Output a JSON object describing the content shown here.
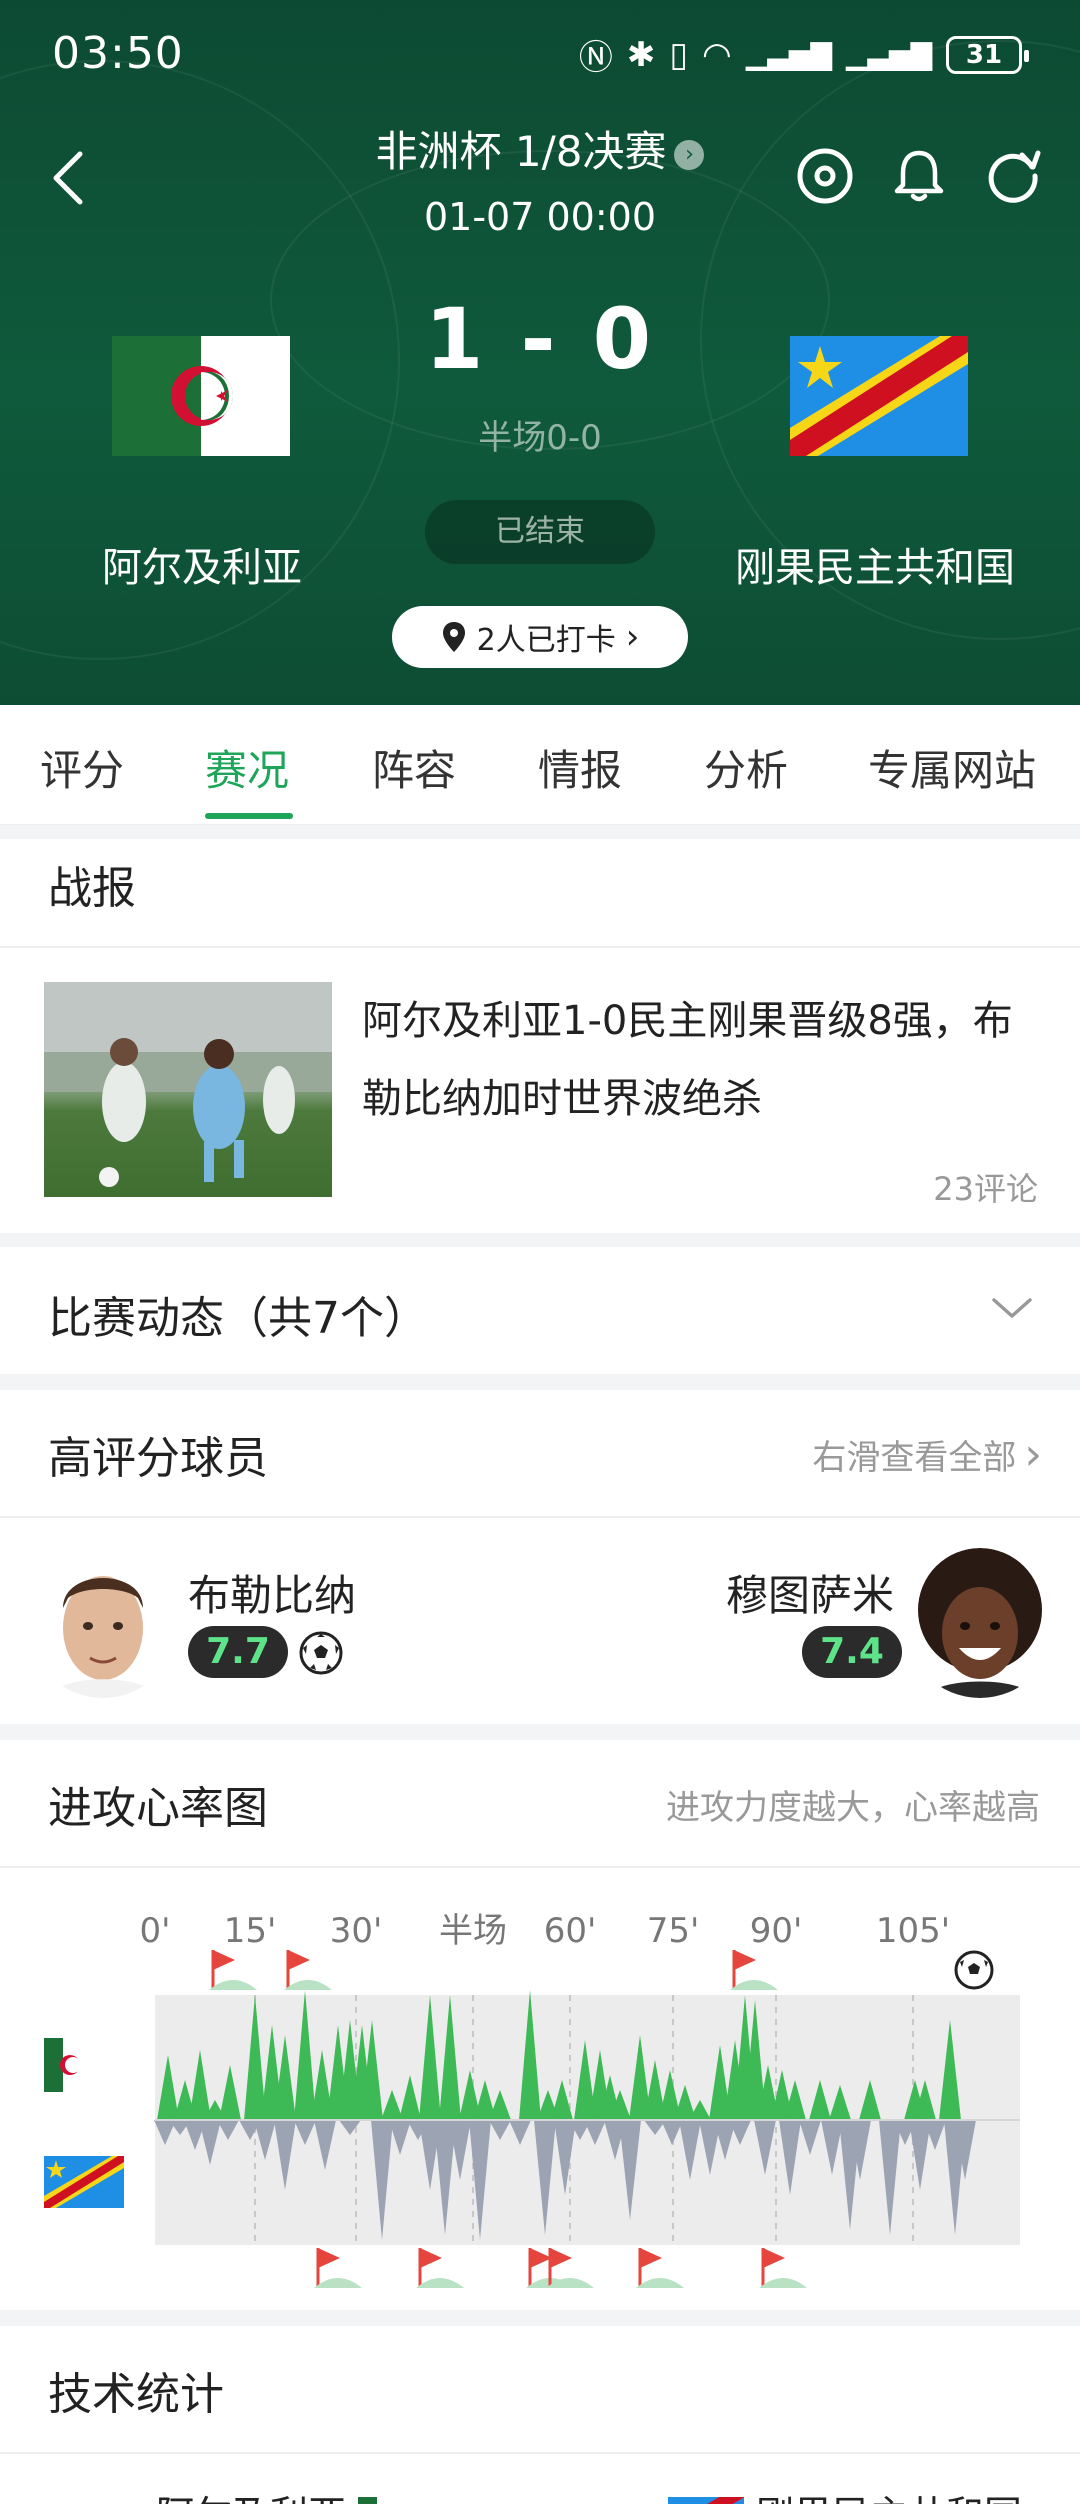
{
  "status_bar": {
    "time": "03:50",
    "battery": "31"
  },
  "header": {
    "competition": "非洲杯 1/8决赛",
    "datetime": "01-07 00:00",
    "score": "1 - 0",
    "half_score": "半场0-0",
    "status": "已结束",
    "home_team": "阿尔及利亚",
    "away_team": "刚果民主共和国",
    "checkin": "2人已打卡"
  },
  "tabs": [
    "评分",
    "赛况",
    "阵容",
    "情报",
    "分析",
    "专属网站"
  ],
  "active_tab": "赛况",
  "report": {
    "title": "战报",
    "headline": "阿尔及利亚1-0民主刚果晋级8强，布勒比纳加时世界波绝杀",
    "comments": "23评论"
  },
  "events": {
    "title": "比赛动态（共7个）"
  },
  "top_players": {
    "title": "高评分球员",
    "more": "右滑查看全部",
    "home": {
      "name": "布勒比纳",
      "rating": "7.7"
    },
    "away": {
      "name": "穆图萨米",
      "rating": "7.4"
    }
  },
  "momentum": {
    "title": "进攻心率图",
    "hint": "进攻力度越大，心率越高",
    "ticks": [
      "0'",
      "15'",
      "30'",
      "半场",
      "60'",
      "75'",
      "90'",
      "105'"
    ],
    "colors": {
      "home": "#3db955",
      "away": "#9ca3b3",
      "bg": "#ececec"
    }
  },
  "stats": {
    "title": "技术统计",
    "home_team": "阿尔及利亚",
    "away_team": "刚果民主共和国"
  },
  "colors": {
    "accent": "#1fa559",
    "header_bg": "#0f5a3c"
  }
}
